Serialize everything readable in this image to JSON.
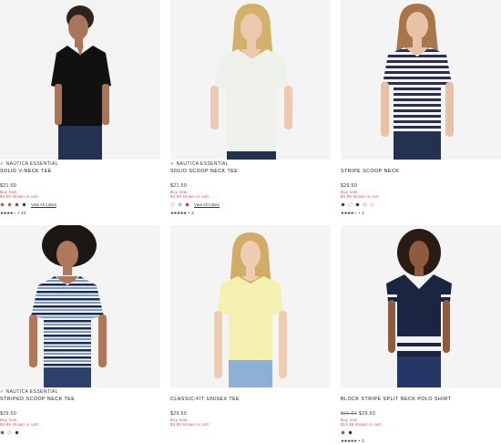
{
  "products": [
    {
      "brand": "NAUTICA ESSENTIAL",
      "name": "SOLID V-NECK TEE",
      "price": "$21.50",
      "promo_line1": "Buy now,",
      "promo_line2": "$4.99 shown in cart",
      "swatch_colors": [
        "#d9435a",
        "#e23d4f",
        "#c71f3a",
        "#1b2a52"
      ],
      "view_all": "View All Colors",
      "stars": "★★★★☆",
      "rating_count": "• 23"
    },
    {
      "brand": "NAUTICA ESSENTIAL",
      "name": "SOLID SCOOP NECK TEE",
      "price": "$21.50",
      "promo_line1": "Buy now,",
      "promo_line2": "$4.99 shown in cart",
      "swatch_colors": [
        "#ececec",
        "#9ec9d8",
        "#cc2a3b"
      ],
      "view_all": "View All Colors",
      "stars": "★★★★★",
      "rating_count": "• 3"
    },
    {
      "brand": "",
      "name": "STRIPE SCOOP NECK",
      "price": "$29.50",
      "promo_line1": "Buy now,",
      "promo_line2": "$4.99 shown in cart",
      "swatch_colors": [
        "#2b2f4a",
        "#f5f5f5",
        "#1b2a52",
        "#f2d6d6",
        "#f6e7e7"
      ],
      "view_all": "",
      "stars": "★★★★☆",
      "rating_count": "• 3"
    },
    {
      "brand": "NAUTICA ESSENTIAL",
      "name": "STRIPED SCOOP NECK TEE",
      "price": "$29.50",
      "promo_line1": "Buy now,",
      "promo_line2": "$4.99 shown in cart",
      "swatch_colors": [
        "#c9252f",
        "#e6e6e6",
        "#1b2a52"
      ],
      "view_all": "",
      "stars": "",
      "rating_count": ""
    },
    {
      "brand": "",
      "name": "CLASSIC-FIT UNISEX TEE",
      "price": "$29.50",
      "promo_line1": "Buy now,",
      "promo_line2": "$4.99 shown in cart",
      "swatch_colors": [],
      "view_all": "",
      "stars": "",
      "rating_count": ""
    },
    {
      "brand": "",
      "name": "BLOCK STRIPE SPLIT NECK POLO SHIRT",
      "price_old": "$91.50",
      "price": "$29.93",
      "promo_line1": "Buy now,",
      "promo_line2": "$14.99 shown in cart",
      "swatch_colors": [
        "#d42b2f",
        "#1b1b22"
      ],
      "view_all": "",
      "stars": "★★★★★",
      "rating_count": "• 3"
    }
  ],
  "colors": {
    "photo_bg": "#f4f4f4",
    "promo": "#c0504d",
    "navy": "#1b2a52"
  }
}
